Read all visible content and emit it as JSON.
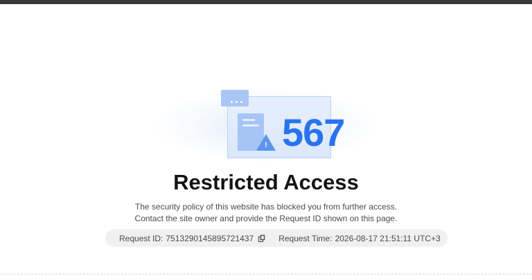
{
  "page": {
    "status_code": "567",
    "title": "Restricted Access",
    "description_line1": "The security policy of this website has blocked you from further access.",
    "description_line2": "Contact the site owner and provide the Request ID shown on this page."
  },
  "request": {
    "id_label": "Request ID:",
    "id_value": "7513290145895721437",
    "time_label": "Request Time:",
    "time_value": "2026-08-17 21:51:11 UTC+3"
  },
  "icons": {
    "copy": "copy-icon",
    "warning": "warning-icon",
    "document": "document-icon"
  },
  "colors": {
    "accent": "#2873ee",
    "illustration_light": "#a6c4f6",
    "pill_background": "#f0f0f0"
  }
}
